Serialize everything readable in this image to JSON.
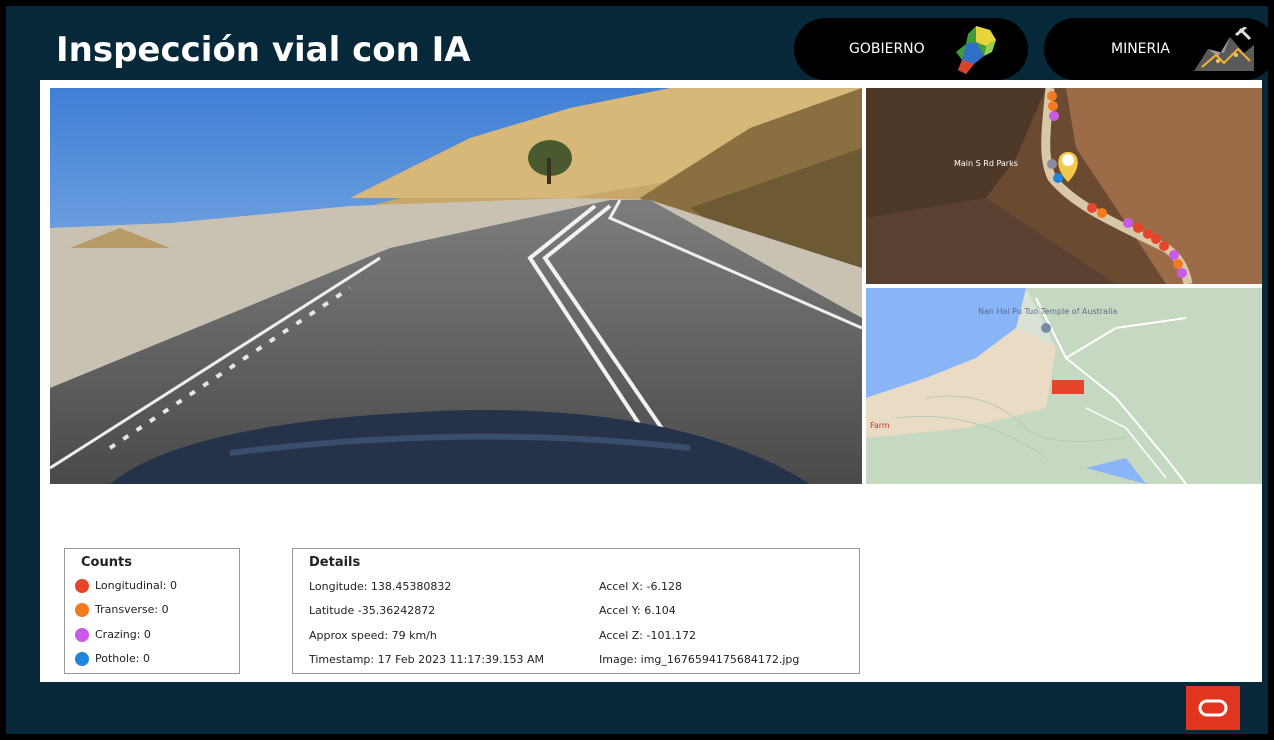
{
  "header": {
    "title": "Inspección vial con IA"
  },
  "nav": [
    {
      "label": "GOBIERNO",
      "icon": "map-region-icon"
    },
    {
      "label": "MINERIA",
      "icon": "mining-icon"
    }
  ],
  "counts": {
    "title": "Counts",
    "items": [
      {
        "label": "Longitudinal: 0",
        "color": "#e8442a"
      },
      {
        "label": "Transverse: 0",
        "color": "#f47a20"
      },
      {
        "label": "Crazing: 0",
        "color": "#c95ae8"
      },
      {
        "label": "Pothole: 0",
        "color": "#1f86e0"
      }
    ]
  },
  "details": {
    "title": "Details",
    "left": [
      "Longitude: 138.45380832",
      "Latitude -35.36242872",
      "Approx speed: 79 km/h",
      "Timestamp: 17 Feb 2023 11:17:39.153 AM"
    ],
    "right": [
      "Accel X: -6.128",
      "Accel Y: 6.104",
      "Accel Z: -101.172",
      "Image: img_1676594175684172.jpg"
    ]
  },
  "satellite_map": {
    "road_label": "Main S Rd Parks"
  },
  "street_map": {
    "place_label": "Nan Hai Pu Tuo Temple of Australia",
    "farm_label": "Farm"
  },
  "footer": {
    "logo": "oracle-logo"
  }
}
